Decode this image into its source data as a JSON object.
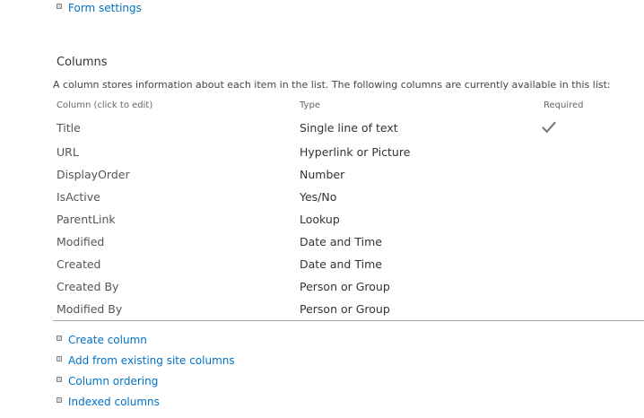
{
  "top_links": {
    "form_settings": "Form settings"
  },
  "columns_section": {
    "title": "Columns",
    "description": "A column stores information about each item in the list. The following columns are currently available in this list:",
    "headers": {
      "column": "Column (click to edit)",
      "type": "Type",
      "required": "Required"
    },
    "rows": [
      {
        "name": "Title",
        "type": "Single line of text",
        "required": true
      },
      {
        "name": "URL",
        "type": "Hyperlink or Picture",
        "required": false
      },
      {
        "name": "DisplayOrder",
        "type": "Number",
        "required": false
      },
      {
        "name": "IsActive",
        "type": "Yes/No",
        "required": false
      },
      {
        "name": "ParentLink",
        "type": "Lookup",
        "required": false
      },
      {
        "name": "Modified",
        "type": "Date and Time",
        "required": false
      },
      {
        "name": "Created",
        "type": "Date and Time",
        "required": false
      },
      {
        "name": "Created By",
        "type": "Person or Group",
        "required": false
      },
      {
        "name": "Modified By",
        "type": "Person or Group",
        "required": false
      }
    ]
  },
  "bottom_links": {
    "create_column": "Create column",
    "add_existing": "Add from existing site columns",
    "column_ordering": "Column ordering",
    "indexed_columns": "Indexed columns"
  },
  "colors": {
    "link": "#0072c6",
    "text": "#444444",
    "checkmark": "#7a7a7a",
    "divider": "#a6a6a6"
  },
  "icons": {
    "bullet": "square-bullet-icon",
    "required": "checkmark-icon"
  }
}
